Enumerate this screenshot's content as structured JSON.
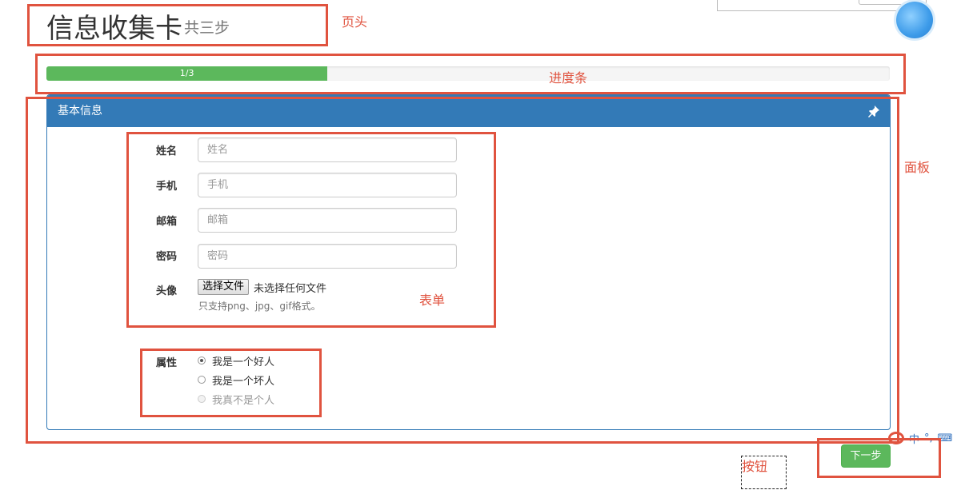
{
  "header": {
    "title": "信息收集卡",
    "subtitle": "共三步"
  },
  "progress": {
    "label": "1/3",
    "fraction": 0.3333
  },
  "panel": {
    "title": "基本信息"
  },
  "form": {
    "fields": [
      {
        "label": "姓名",
        "placeholder": "姓名"
      },
      {
        "label": "手机",
        "placeholder": "手机"
      },
      {
        "label": "邮箱",
        "placeholder": "邮箱"
      },
      {
        "label": "密码",
        "placeholder": "密码"
      }
    ],
    "avatar": {
      "label": "头像",
      "button_label": "选择文件",
      "status": "未选择任何文件",
      "help": "只支持png、jpg、gif格式。"
    },
    "attribute": {
      "label": "属性",
      "options": [
        {
          "label": "我是一个好人",
          "checked": true,
          "disabled": false
        },
        {
          "label": "我是一个坏人",
          "checked": false,
          "disabled": false
        },
        {
          "label": "我真不是个人",
          "checked": false,
          "disabled": true
        }
      ]
    }
  },
  "actions": {
    "next_label": "下一步"
  },
  "annotations": {
    "header": "页头",
    "progress": "进度条",
    "panel": "面板",
    "form": "表单",
    "button": "按钮"
  },
  "ime": {
    "lang": "中",
    "punct": "°,",
    "keyboard": "⌨"
  },
  "colors": {
    "annotation": "#e0533f",
    "primary": "#337ab7",
    "success": "#5cb85c"
  }
}
